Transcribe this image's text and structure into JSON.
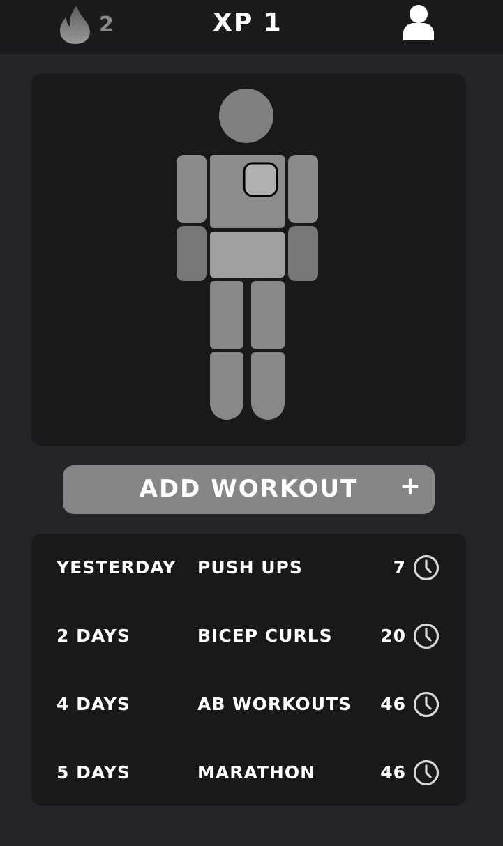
{
  "header": {
    "streak_count": "2",
    "xp_label": "XP 1",
    "streak_icon": "flame-icon",
    "profile_icon": "user-icon"
  },
  "body_map": {
    "selected_part": "chest",
    "colors": {
      "head": "#808080",
      "limb": "#8a8a8a",
      "torso": "#8c8c8c",
      "abdomen": "#a0a0a0",
      "selected_fill": "#b0b0b0",
      "selected_outline": "#000000"
    }
  },
  "add_workout": {
    "label": "ADD WORKOUT",
    "plus": "+"
  },
  "history": {
    "rows": [
      {
        "when": "YESTERDAY",
        "name": "PUSH UPS",
        "minutes": "7"
      },
      {
        "when": "2 DAYS",
        "name": "BICEP CURLS",
        "minutes": "20"
      },
      {
        "when": "4 DAYS",
        "name": "AB WORKOUTS",
        "minutes": "46"
      },
      {
        "when": "5 DAYS",
        "name": "MARATHON",
        "minutes": "46"
      }
    ]
  },
  "colors": {
    "page_bg": "#232428",
    "topbar_bg": "#1b1b1e",
    "card_bg": "#19191c",
    "button_bg": "#868686",
    "text": "#ffffff",
    "muted_text": "#8a8a8a"
  }
}
